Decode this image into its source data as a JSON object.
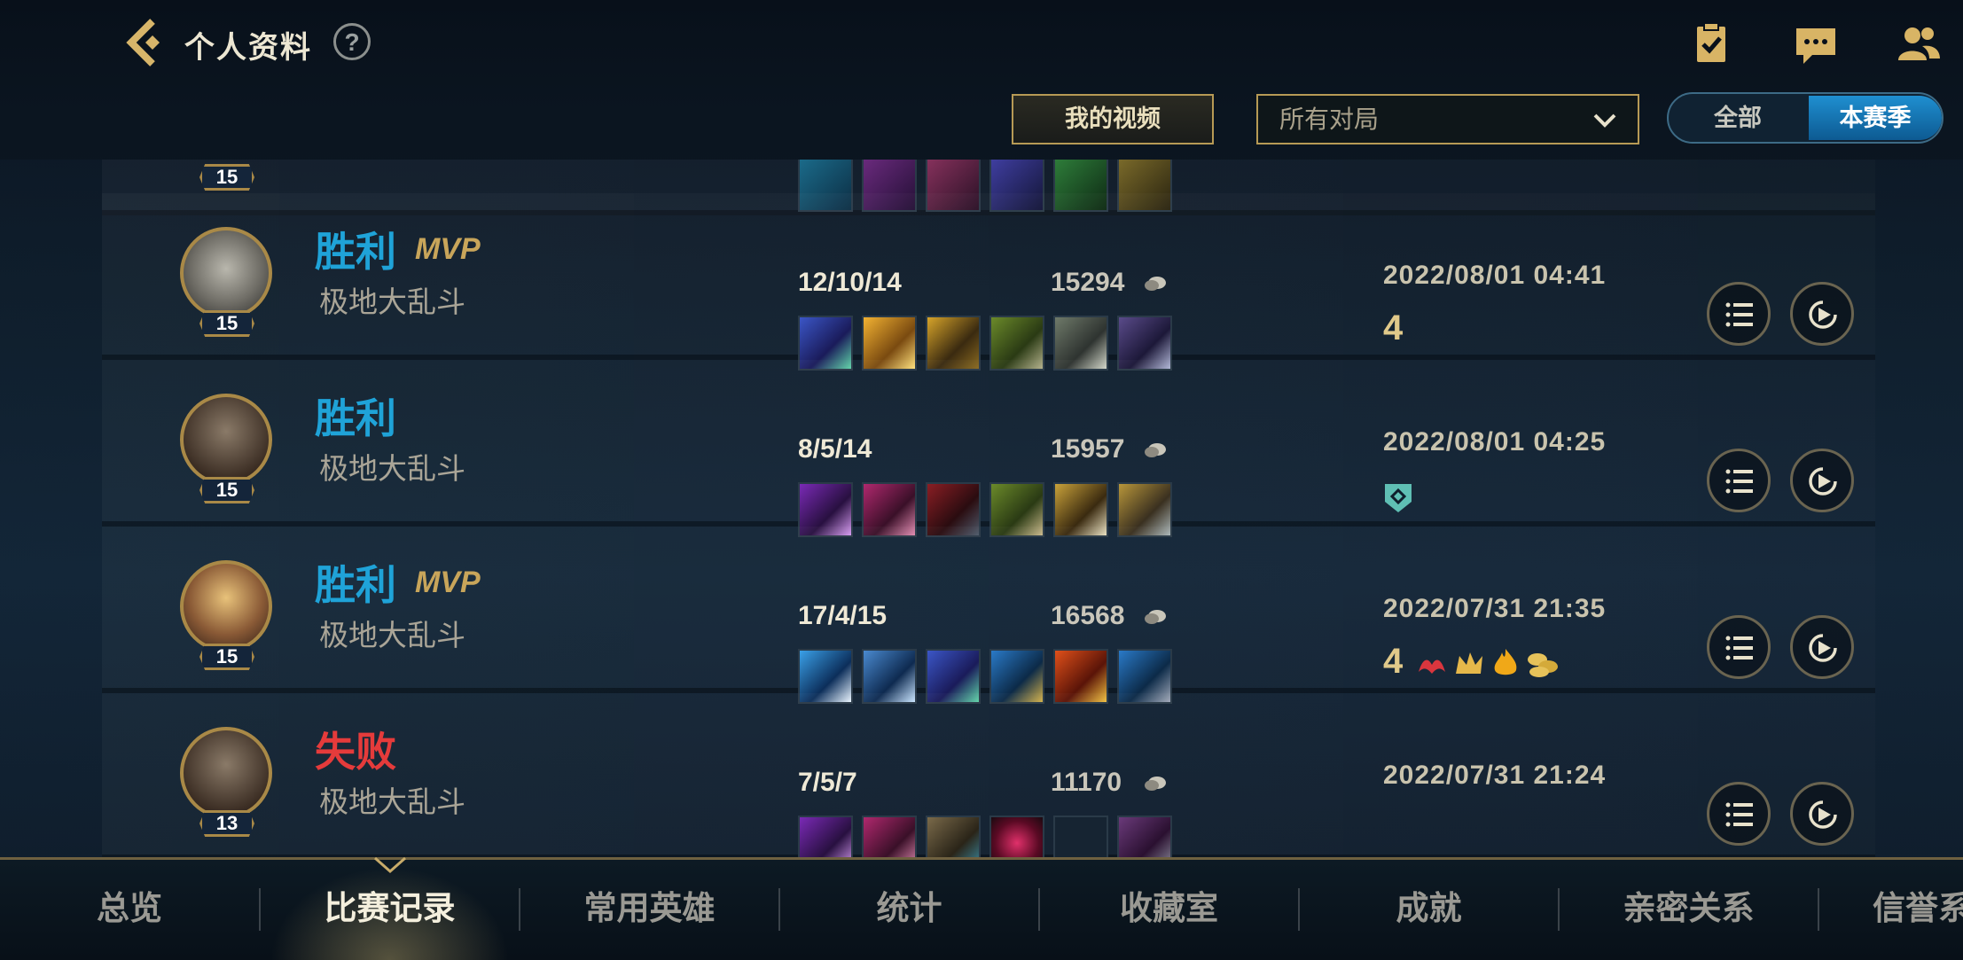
{
  "header": {
    "title": "个人资料",
    "help_label": "?",
    "icons": [
      "back-icon",
      "help-icon",
      "checklist-icon",
      "chat-icon",
      "friends-icon"
    ]
  },
  "filters": {
    "video_button": "我的视频",
    "mode_select": {
      "value": "所有对局"
    },
    "toggle": {
      "all": "全部",
      "season": "本赛季",
      "selected": "本赛季"
    }
  },
  "partial_top_row": {
    "level": "15"
  },
  "matches": [
    {
      "result": "胜利",
      "outcome": "win",
      "mvp": "MVP",
      "mode": "极地大乱斗",
      "level": "15",
      "kda": "12/10/14",
      "gold": "15294",
      "datetime": "2022/08/01 04:41",
      "badges": [
        "quadra-kill"
      ]
    },
    {
      "result": "胜利",
      "outcome": "win",
      "mvp": "",
      "mode": "极地大乱斗",
      "level": "15",
      "kda": "8/5/14",
      "gold": "15957",
      "datetime": "2022/08/01 04:25",
      "badges": [
        "shield"
      ]
    },
    {
      "result": "胜利",
      "outcome": "win",
      "mvp": "MVP",
      "mode": "极地大乱斗",
      "level": "15",
      "kda": "17/4/15",
      "gold": "16568",
      "datetime": "2022/07/31 21:35",
      "badges": [
        "quadra-kill",
        "first-blood",
        "crown",
        "flame",
        "coins"
      ]
    },
    {
      "result": "失败",
      "outcome": "loss",
      "mvp": "",
      "mode": "极地大乱斗",
      "level": "13",
      "kda": "7/5/7",
      "gold": "11170",
      "datetime": "2022/07/31 21:24",
      "badges": []
    }
  ],
  "quadra_glyph": "4",
  "tabs": [
    {
      "label": "总览"
    },
    {
      "label": "比赛记录",
      "active": true
    },
    {
      "label": "常用英雄"
    },
    {
      "label": "统计"
    },
    {
      "label": "收藏室"
    },
    {
      "label": "成就"
    },
    {
      "label": "亲密关系"
    },
    {
      "label": "信誉系"
    }
  ],
  "colors": {
    "win": "#1fa3d8",
    "loss": "#e53b3b",
    "gold_border": "#b79a55",
    "active_toggle": "#1f8fd0"
  }
}
